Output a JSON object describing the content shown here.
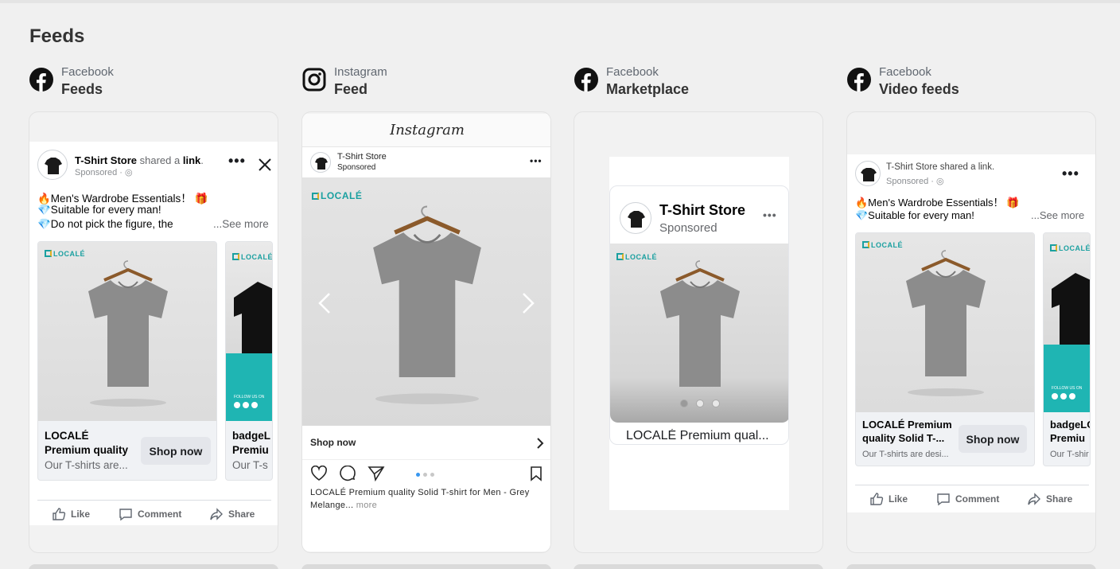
{
  "page": {
    "title": "Feeds"
  },
  "columns": [
    {
      "platform": "Facebook",
      "placement": "Feeds",
      "icon": "facebook-icon"
    },
    {
      "platform": "Instagram",
      "placement": "Feed",
      "icon": "instagram-icon"
    },
    {
      "platform": "Facebook",
      "placement": "Marketplace",
      "icon": "facebook-icon"
    },
    {
      "platform": "Facebook",
      "placement": "Video feeds",
      "icon": "facebook-icon"
    }
  ],
  "fb_feed": {
    "store": "T-Shirt Store",
    "shared_text": "shared a",
    "link_word": "link",
    "sponsored": "Sponsored",
    "line1": "🔥Men's Wardrobe Essentials！ 🎁",
    "line2": "💎Suitable for every man!",
    "line3": "💎Do not pick the figure, the",
    "see_more": "...See more",
    "card1": {
      "title1": "LOCALÉ",
      "title2": "Premium quality",
      "desc": "Our T-shirts are...",
      "cta": "Shop now",
      "logo": "LOCALÉ"
    },
    "card2": {
      "title1": "badgeL",
      "title2": "Premiu",
      "desc": "Our T-s",
      "logo": "LOCALÉ",
      "follow": "FOLLOW US ON"
    },
    "actions": {
      "like": "Like",
      "comment": "Comment",
      "share": "Share"
    }
  },
  "ig_feed": {
    "wordmark": "Instagram",
    "store": "T-Shirt Store",
    "sponsored": "Sponsored",
    "logo": "LOCALÉ",
    "shop_now": "Shop now",
    "caption": "LOCALÉ Premium quality Solid T-shirt for Men - Grey Melange...",
    "more": "more"
  },
  "marketplace": {
    "store": "T-Shirt Store",
    "sponsored": "Sponsored",
    "logo": "LOCALÉ",
    "title": "LOCALÉ Premium qual..."
  },
  "video_feed": {
    "header": "T-Shirt Store shared a link.",
    "sponsored": "Sponsored",
    "line1": "🔥Men's Wardrobe Essentials！ 🎁",
    "line2": "💎Suitable for every man!",
    "see_more": "...See more",
    "card1": {
      "title1": "LOCALÉ Premium",
      "title2": "quality Solid T-...",
      "desc": "Our T-shirts are desi...",
      "cta": "Shop now",
      "logo": "LOCALÉ"
    },
    "card2": {
      "title1": "badgeLO",
      "title2": "Premiu",
      "desc": "Our T-shir",
      "logo": "LOCALÉ",
      "follow": "FOLLOW US ON"
    },
    "actions": {
      "like": "Like",
      "comment": "Comment",
      "share": "Share"
    }
  },
  "colors": {
    "background": "#f0f0f0",
    "teal_brand": "#1fb5b3",
    "shirt_grey": "#8a8a8a"
  }
}
